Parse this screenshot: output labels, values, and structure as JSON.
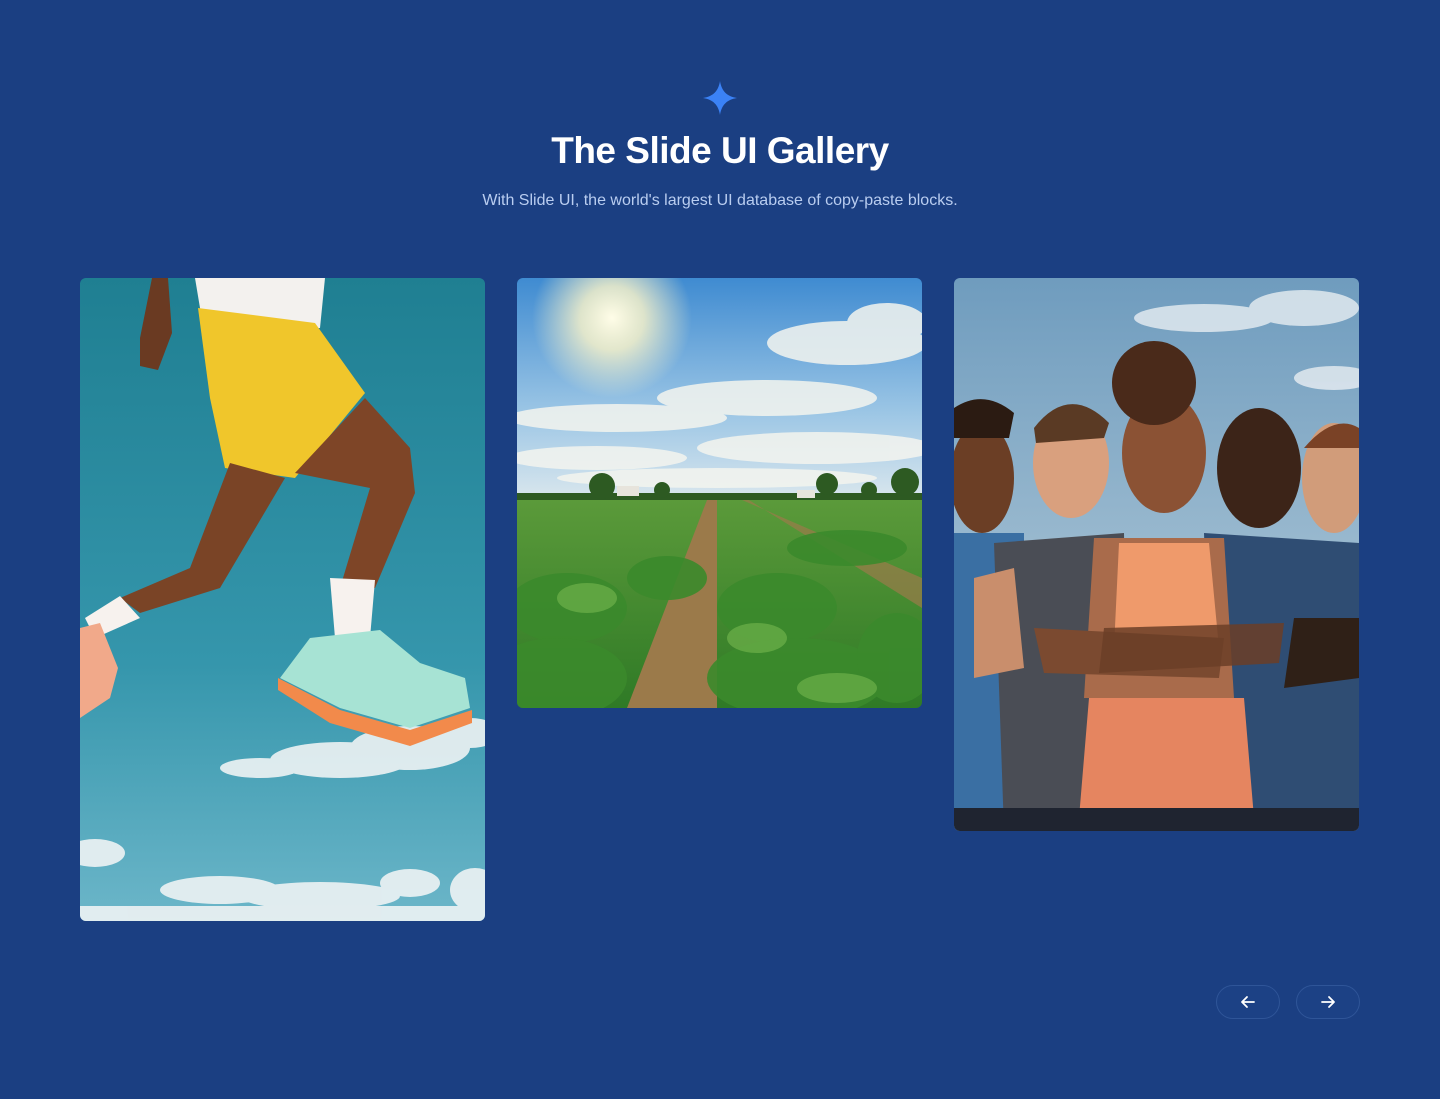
{
  "header": {
    "icon": "sparkle-icon",
    "title": "The Slide UI Gallery",
    "subtitle": "With Slide UI, the world's largest UI database of copy-paste blocks."
  },
  "gallery": {
    "images": [
      {
        "name": "runner-jumping-image"
      },
      {
        "name": "crop-field-image"
      },
      {
        "name": "athletes-group-image"
      }
    ]
  },
  "navigation": {
    "prev_icon": "arrow-left-icon",
    "next_icon": "arrow-right-icon"
  },
  "colors": {
    "background": "#1b3f82",
    "accent": "#3b82f6",
    "title": "#ffffff",
    "subtitle": "#b9cdf0"
  }
}
